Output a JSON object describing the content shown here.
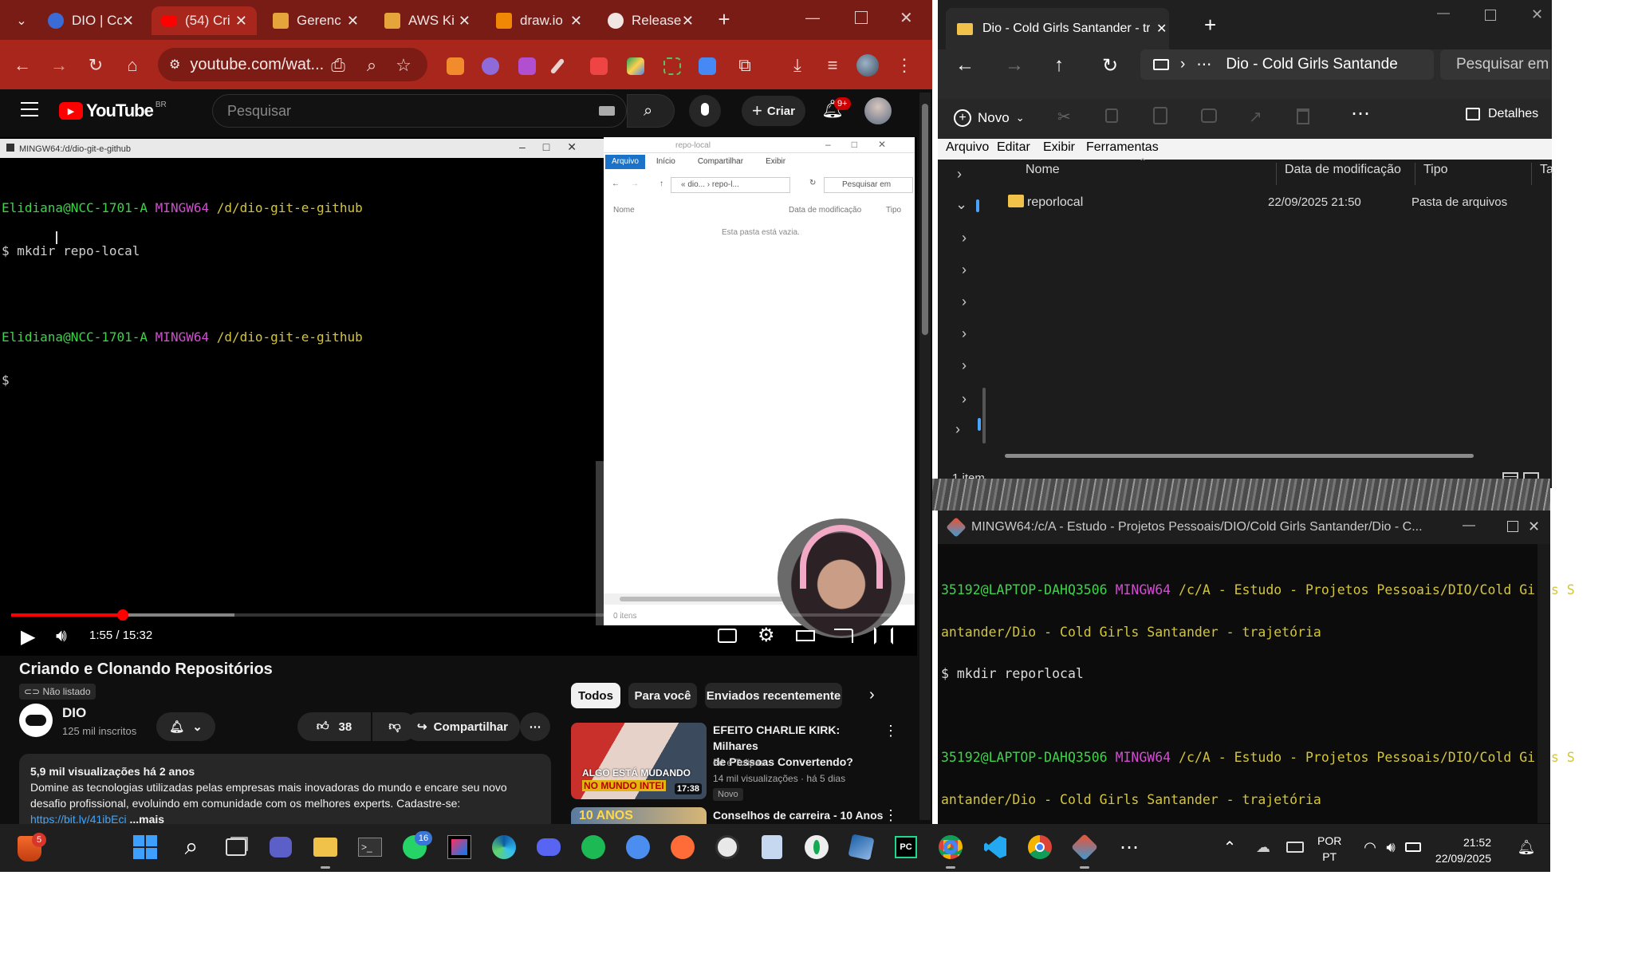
{
  "browser": {
    "tabs": [
      {
        "label": "DIO | Co",
        "icon": "dio-favicon",
        "active": false
      },
      {
        "label": "(54) Cri",
        "icon": "youtube-favicon",
        "active": true
      },
      {
        "label": "Gerenc",
        "icon": "aws-favicon",
        "active": false
      },
      {
        "label": "AWS Ki",
        "icon": "aws-favicon",
        "active": false
      },
      {
        "label": "draw.io",
        "icon": "drawio-favicon",
        "active": false
      },
      {
        "label": "Release",
        "icon": "github-favicon",
        "active": false
      }
    ],
    "url": "youtube.com/wat...",
    "colors": {
      "tabbar": "#7a1c16",
      "toolbar": "#a9261d"
    }
  },
  "youtube": {
    "logo_text": "YouTube",
    "region": "BR",
    "search_placeholder": "Pesquisar",
    "create_label": "Criar",
    "notifications": "9+",
    "video": {
      "title": "Criando e Clonando Repositórios",
      "visibility": "Não listado",
      "time": "1:55 / 15:32",
      "progress_fraction": 0.124
    },
    "channel": {
      "name": "DIO",
      "subscribers": "125 mil inscritos"
    },
    "likes": "38",
    "share_label": "Compartilhar",
    "description": {
      "stats": "5,9 mil visualizações  há 2 anos",
      "line1": "Domine as tecnologias utilizadas pelas empresas mais inovadoras do mundo e encare seu novo",
      "line2": "desafio profissional, evoluindo em comunidade com os melhores experts. Cadastre-se:",
      "link": "https://bit.ly/41ibEci",
      "more": "...mais"
    },
    "chips": [
      "Todos",
      "Para você",
      "Enviados recentemente"
    ],
    "recommendations": [
      {
        "title_line1": "EFEITO CHARLIE KIRK: Milhares",
        "title_line2": "de Pessoas Convertendo?",
        "channel": "Fé e Tulipas",
        "meta": "14 mil visualizações · há 5 dias",
        "badge": "Novo",
        "duration": "17:38",
        "thumb_text_1": "ALGO ESTÁ MUDANDO",
        "thumb_text_2": "NO MUNDO INTEI"
      },
      {
        "title_line1": "Conselhos de carreira - 10 Anos",
        "thumb_text_1": "10 ANOS"
      }
    ]
  },
  "video_content": {
    "terminal": {
      "title": "MINGW64:/d/dio-git-e-github",
      "lines": [
        {
          "user": "Elidiana@NCC-1701-A",
          "env": "MINGW64",
          "path": "/d/dio-git-e-github"
        },
        {
          "cmd": "$ mkdir repo-local"
        },
        {
          "user": "Elidiana@NCC-1701-A",
          "env": "MINGW64",
          "path": "/d/dio-git-e-github"
        },
        {
          "cmd": "$"
        }
      ]
    },
    "explorer": {
      "title": "repo-local",
      "ribbon": [
        "Arquivo",
        "Início",
        "Compartilhar",
        "Exibir"
      ],
      "path": "« dio... › repo-l...",
      "search": "Pesquisar em",
      "col_name": "Nome",
      "col_date": "Data de modificação",
      "col_type": "Tipo",
      "empty": "Esta pasta está vazia.",
      "status": "0 itens"
    }
  },
  "file_explorer": {
    "tab_title": "Dio - Cold Girls Santander - tra",
    "breadcrumb": "Dio - Cold Girls Santande",
    "search": "Pesquisar em D",
    "new_label": "Novo",
    "details_label": "Detalhes",
    "menu": [
      "Arquivo",
      "Editar",
      "Exibir",
      "Ferramentas"
    ],
    "columns": {
      "name": "Nome",
      "date": "Data de modificação",
      "type": "Tipo",
      "size": "Ta"
    },
    "rows": [
      {
        "name": "reporlocal",
        "date": "22/09/2025 21:50",
        "type": "Pasta de arquivos"
      }
    ],
    "status": "1 item"
  },
  "mingw": {
    "title": "MINGW64:/c/A - Estudo - Projetos Pessoais/DIO/Cold Girls Santander/Dio - C...",
    "lines": [
      {
        "user": "35192@LAPTOP-DAHQ3506",
        "env": "MINGW64",
        "path": "/c/A - Estudo - Projetos Pessoais/DIO/Cold Girls S"
      },
      {
        "cont": "antander/Dio - Cold Girls Santander - trajetória"
      },
      {
        "cmd": "$ mkdir reporlocal"
      },
      {
        "user": "35192@LAPTOP-DAHQ3506",
        "env": "MINGW64",
        "path": "/c/A - Estudo - Projetos Pessoais/DIO/Cold Girls S"
      },
      {
        "cont": "antander/Dio - Cold Girls Santander - trajetória"
      },
      {
        "cmd": "$"
      }
    ]
  },
  "taskbar": {
    "lang_top": "POR",
    "lang_bottom": "PT",
    "time": "21:52",
    "date": "22/09/2025",
    "badges": {
      "widgets": "5",
      "whatsapp": "16"
    }
  }
}
